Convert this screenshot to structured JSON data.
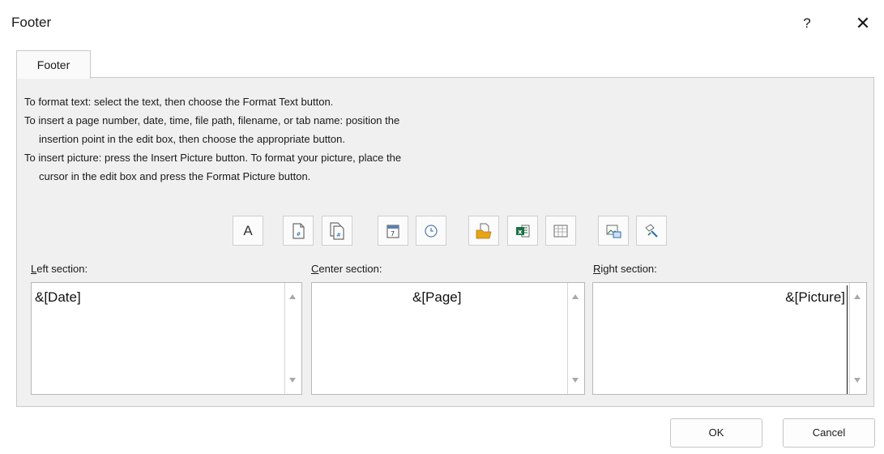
{
  "dialog": {
    "title": "Footer",
    "help_label": "?",
    "close_label": "✕"
  },
  "tabs": [
    {
      "label": "Footer"
    }
  ],
  "instructions": {
    "line1": "To format text:  select the text, then choose the Format Text button.",
    "line2": "To insert a page number, date, time, file path, filename, or tab name:  position the",
    "line3": "insertion point in the edit box, then choose the appropriate button.",
    "line4": "To insert picture: press the Insert Picture button.  To format your picture, place the",
    "line5": "cursor in the edit box and press the Format Picture button."
  },
  "toolbar": {
    "format_text_label": "A",
    "buttons": [
      {
        "icon": "format-text-icon"
      },
      {
        "icon": "insert-page-number-icon"
      },
      {
        "icon": "insert-number-of-pages-icon"
      },
      {
        "icon": "insert-date-icon"
      },
      {
        "icon": "insert-time-icon"
      },
      {
        "icon": "insert-file-path-icon"
      },
      {
        "icon": "insert-file-name-icon"
      },
      {
        "icon": "insert-sheet-name-icon"
      },
      {
        "icon": "insert-picture-icon"
      },
      {
        "icon": "format-picture-icon"
      }
    ]
  },
  "sections": {
    "left": {
      "label_key": "L",
      "label_rest": "eft section:",
      "value": "&[Date]"
    },
    "center": {
      "label_key": "C",
      "label_rest": "enter section:",
      "value": "&[Page]"
    },
    "right": {
      "label_key": "R",
      "label_rest": "ight section:",
      "value": "&[Picture]"
    }
  },
  "buttons": {
    "ok_label": "OK",
    "cancel_label": "Cancel"
  },
  "colors": {
    "panel_bg": "#f0f0f0",
    "folder_yellow": "#e8a317",
    "excel_green": "#1e7145",
    "icon_blue": "#2b6cb0"
  }
}
